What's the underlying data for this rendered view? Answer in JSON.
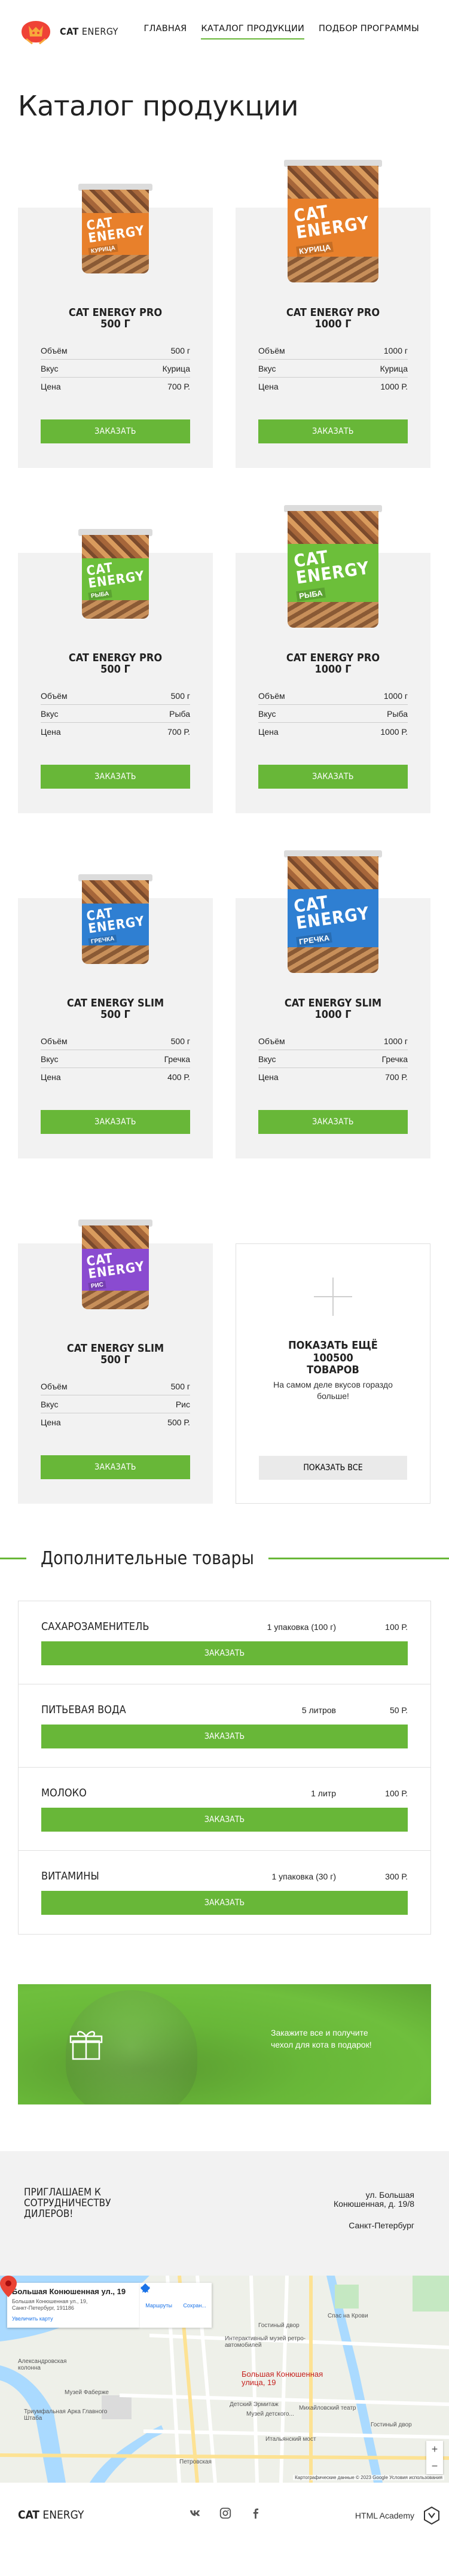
{
  "header": {
    "logo_text_bold": "CAT",
    "logo_text": "ENERGY",
    "nav": [
      {
        "label": "Главная",
        "active": false
      },
      {
        "label": "Каталог продукции",
        "active": true
      },
      {
        "label": "Подбор программы",
        "active": false
      }
    ]
  },
  "page_title": "Каталог продукции",
  "products": [
    {
      "title": "CAT ENERGY PRO",
      "size": "500 г",
      "flavor_label": "КУРИЦА",
      "brand": "CAT ENERGY",
      "specs": [
        [
          "Объём",
          "500 г"
        ],
        [
          "Вкус",
          "Курица"
        ],
        [
          "Цена",
          "700 Р."
        ]
      ],
      "button": "Заказать",
      "color": "#e8802b"
    },
    {
      "title": "CAT ENERGY PRO",
      "size": "1000 г",
      "flavor_label": "КУРИЦА",
      "brand": "CAT ENERGY",
      "specs": [
        [
          "Объём",
          "1000 г"
        ],
        [
          "Вкус",
          "Курица"
        ],
        [
          "Цена",
          "1000 Р."
        ]
      ],
      "button": "Заказать",
      "color": "#e8802b"
    },
    {
      "title": "CAT ENERGY PRO",
      "size": "500 г",
      "flavor_label": "РЫБА",
      "brand": "CAT ENERGY",
      "specs": [
        [
          "Объём",
          "500 г"
        ],
        [
          "Вкус",
          "Рыба"
        ],
        [
          "Цена",
          "700 Р."
        ]
      ],
      "button": "Заказать",
      "color": "#6cbf3a"
    },
    {
      "title": "CAT ENERGY PRO",
      "size": "1000 г",
      "flavor_label": "РЫБА",
      "brand": "CAT ENERGY",
      "specs": [
        [
          "Объём",
          "1000 г"
        ],
        [
          "Вкус",
          "Рыба"
        ],
        [
          "Цена",
          "1000 Р."
        ]
      ],
      "button": "Заказать",
      "color": "#6cbf3a"
    },
    {
      "title": "CAT ENERGY SLIM",
      "size": "500 г",
      "flavor_label": "ГРЕЧКА",
      "brand": "CAT ENERGY",
      "specs": [
        [
          "Объём",
          "500 г"
        ],
        [
          "Вкус",
          "Гречка"
        ],
        [
          "Цена",
          "400 Р."
        ]
      ],
      "button": "Заказать",
      "color": "#2f7fd2"
    },
    {
      "title": "CAT ENERGY SLIM",
      "size": "1000 г",
      "flavor_label": "ГРЕЧКА",
      "brand": "CAT ENERGY",
      "specs": [
        [
          "Объём",
          "1000 г"
        ],
        [
          "Вкус",
          "Гречка"
        ],
        [
          "Цена",
          "700 Р."
        ]
      ],
      "button": "Заказать",
      "color": "#2f7fd2"
    },
    {
      "title": "CAT ENERGY SLIM",
      "size": "500 г",
      "flavor_label": "РИС",
      "brand": "CAT ENERGY",
      "specs": [
        [
          "Объём",
          "500 г"
        ],
        [
          "Вкус",
          "Рис"
        ],
        [
          "Цена",
          "500 Р."
        ]
      ],
      "button": "Заказать",
      "color": "#8a4bd0"
    }
  ],
  "more": {
    "title": "Показать ещё 100500 товаров",
    "text": "На самом деле вкусов гораздо больше!",
    "button": "Показать все"
  },
  "extra": {
    "heading": "Дополнительные товары",
    "items": [
      {
        "name": "Сахарозаменитель",
        "qty": "1 упаковка (100 г)",
        "price": "100 Р.",
        "button": "Заказать"
      },
      {
        "name": "Питьевая вода",
        "qty": "5 литров",
        "price": "50 Р.",
        "button": "Заказать"
      },
      {
        "name": "Молоко",
        "qty": "1 литр",
        "price": "100 Р.",
        "button": "Заказать"
      },
      {
        "name": "Витамины",
        "qty": "1 упаковка (30 г)",
        "price": "300 Р.",
        "button": "Заказать"
      }
    ]
  },
  "promo": {
    "text": "Закажите все и получите чехол для кота в подарок!"
  },
  "dealers": {
    "title": "Приглашаем к сотрудничеству дилеров!",
    "address_line1": "ул. Большая",
    "address_line2": "Конюшенная, д. 19/8",
    "address_line3": "Санкт-Петербург"
  },
  "map": {
    "info_title": "Большая Конюшенная ул., 19",
    "info_sub": "Большая Конюшенная ул., 19, Санкт-Петербург, 191186",
    "info_link": "Увеличить карту",
    "action_route": "Маршруты",
    "action_save": "Сохран...",
    "pin_label_1": "Большая Конюшенная",
    "pin_label_2": "улица, 19",
    "labels": [
      "Спас на Крови",
      "Гостиный двор",
      "Александровская колонна",
      "Музей Фаберже",
      "Итальянский мост",
      "Детский Эрмитаж",
      "Михайловский театр",
      "Музей детского...",
      "Интерактивный музей ретро-автомобилей",
      "Триумфальная Арка Главного Штаба",
      "Гостиный двор",
      "Петровская"
    ],
    "zoom_in": "+",
    "zoom_out": "−",
    "copyright": "Картографические данные © 2023 Google  Условия использования"
  },
  "footer": {
    "logo_bold": "CAT",
    "logo_text": "ENERGY",
    "academy": "HTML Academy"
  }
}
